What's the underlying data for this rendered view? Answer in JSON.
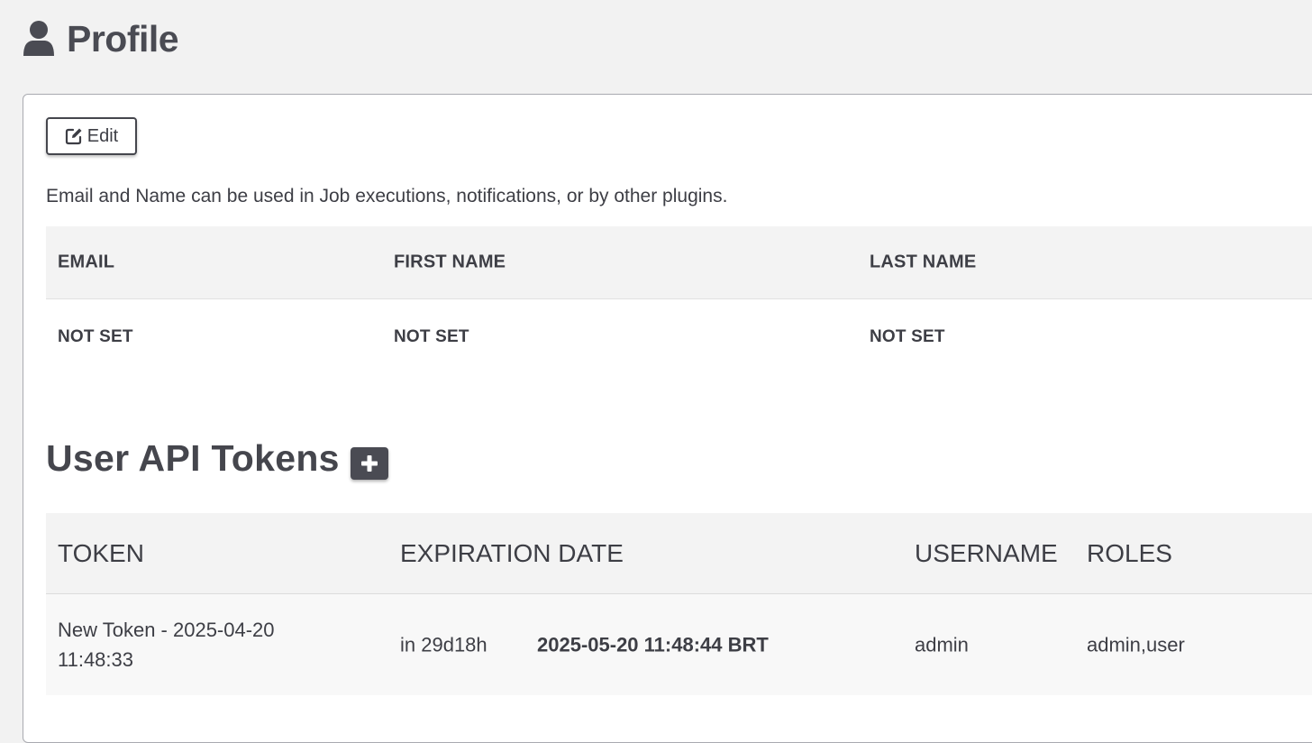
{
  "page": {
    "title": "Profile",
    "icon": "user-icon"
  },
  "profile": {
    "edit_label": "Edit",
    "help_text": "Email and Name can be used in Job executions, notifications, or by other plugins.",
    "columns": [
      "EMAIL",
      "FIRST NAME",
      "LAST NAME"
    ],
    "values": [
      "NOT SET",
      "NOT SET",
      "NOT SET"
    ]
  },
  "tokens": {
    "title": "User API Tokens",
    "add_icon": "plus-icon",
    "columns": [
      "TOKEN",
      "EXPIRATION DATE",
      "USERNAME",
      "ROLES"
    ],
    "rows": [
      {
        "token": "New Token - 2025-04-20 11:48:33",
        "expires_in": "in 29d18h",
        "expiration_date": "2025-05-20 11:48:44 BRT",
        "username": "admin",
        "roles": "admin,user"
      }
    ]
  },
  "colors": {
    "background": "#f2f2f2",
    "text": "#3d3e45",
    "button_dark": "#4a4b53",
    "card": "#ffffff"
  }
}
